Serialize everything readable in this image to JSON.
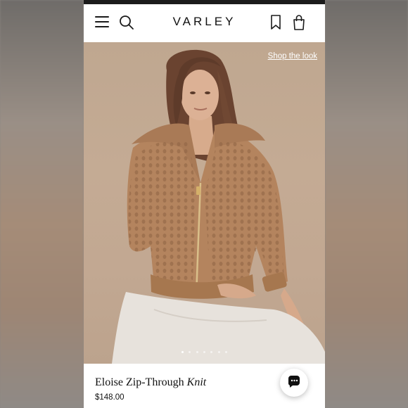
{
  "header": {
    "logo": "VARLEY",
    "icons": [
      "hamburger-menu-icon",
      "search-icon",
      "bookmark-icon",
      "shopping-bag-icon"
    ]
  },
  "hero": {
    "shop_the_look": "Shop the look",
    "carousel_dots": 7,
    "active_dot": 1
  },
  "product": {
    "name_main": "Eloise Zip-Through",
    "name_italic": "Knit",
    "price": "$148.00"
  },
  "chat": {
    "icon": "chat-bubble-icon"
  },
  "colors": {
    "header_bg": "#ffffff",
    "text": "#111111",
    "hero_bg": "#c2a892",
    "sweater": "#b4845e"
  }
}
